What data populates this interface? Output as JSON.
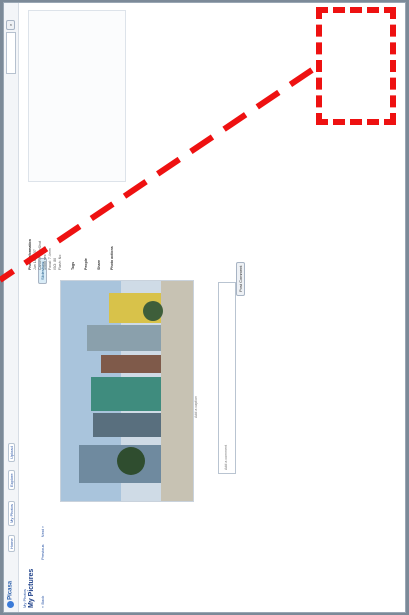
{
  "app": {
    "logo_text": "Picasa",
    "brand_color": "#2b5fab"
  },
  "nav": {
    "links": [
      "Home",
      "My Photos",
      "Explore",
      "Upload"
    ]
  },
  "breadcrumb": {
    "user_label": "My Photos",
    "album_title": "My Pictures"
  },
  "subnav": {
    "back": "« Back",
    "prev": "Previous",
    "next": "Next »",
    "slideshow": "Slideshow"
  },
  "photo": {
    "caption": "Add a caption"
  },
  "comments": {
    "placeholder": "Add a comment",
    "post_label": "Post Comment"
  },
  "sidebar": {
    "info_title": "Photo information",
    "info_lines": [
      "Jun 18, 2007",
      "Canon PowerShot",
      "1/500 sec f/4.0",
      "Focal: 7.4mm",
      "ISO: 80",
      "Flash: No"
    ],
    "tags_title": "Tags",
    "people_title": "People",
    "share_title": "Share",
    "actions_title": "Photo actions"
  },
  "colors": {
    "highlight": "#ee1111",
    "background": "#7c8a98"
  }
}
